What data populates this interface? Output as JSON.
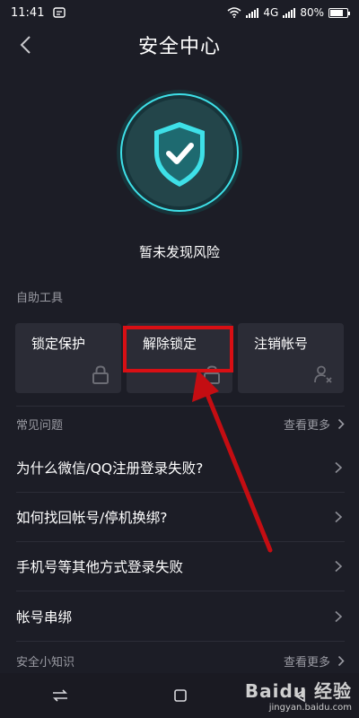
{
  "status_bar": {
    "time": "11:41",
    "network": "4G",
    "battery": "80%",
    "battery_level": 0.8
  },
  "header": {
    "title": "安全中心"
  },
  "shield": {
    "status_text": "暂未发现风险",
    "accent_color": "#3ee0e8"
  },
  "tools": {
    "section_title": "自助工具",
    "items": [
      {
        "label": "锁定保护",
        "icon": "lock-icon"
      },
      {
        "label": "解除锁定",
        "icon": "unlock-icon"
      },
      {
        "label": "注销帐号",
        "icon": "user-remove-icon"
      }
    ]
  },
  "faq": {
    "section_title": "常见问题",
    "more_label": "查看更多",
    "items": [
      {
        "question": "为什么微信/QQ注册登录失败?"
      },
      {
        "question": "如何找回帐号/停机换绑?"
      },
      {
        "question": "手机号等其他方式登录失败"
      },
      {
        "question": "帐号串绑"
      }
    ]
  },
  "tips": {
    "section_title": "安全小知识",
    "more_label": "查看更多"
  },
  "annotation": {
    "highlight_color": "#d80f14"
  },
  "watermark": {
    "brand": "Baidu 经验",
    "url": "jingyan.baidu.com"
  }
}
